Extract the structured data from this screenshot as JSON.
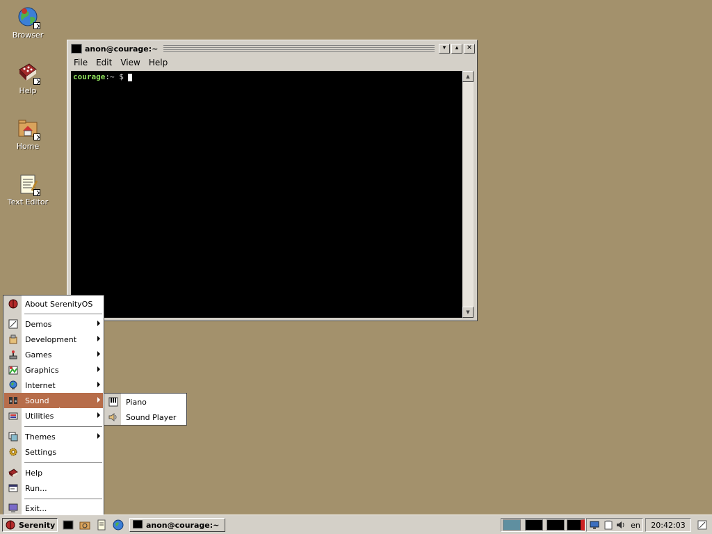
{
  "desktop": {
    "icons": [
      {
        "label": "Browser",
        "icon": "globe-icon"
      },
      {
        "label": "Help",
        "icon": "help-book-icon"
      },
      {
        "label": "Home",
        "icon": "home-folder-icon"
      },
      {
        "label": "Text Editor",
        "icon": "text-editor-icon"
      }
    ]
  },
  "window": {
    "title": "anon@courage:~",
    "menus": [
      "File",
      "Edit",
      "View",
      "Help"
    ],
    "prompt_host": "courage",
    "prompt_rest": ":~ $ ",
    "colors": {
      "terminal_bg": "#000000",
      "prompt": "#8fe05c"
    }
  },
  "start_menu": {
    "items": [
      {
        "label": "About SerenityOS",
        "icon": "serenity-ladybug-icon",
        "submenu": false
      },
      {
        "label": "Demos",
        "icon": "demos-icon",
        "submenu": true
      },
      {
        "label": "Development",
        "icon": "development-icon",
        "submenu": true
      },
      {
        "label": "Games",
        "icon": "joystick-icon",
        "submenu": true
      },
      {
        "label": "Graphics",
        "icon": "graphics-icon",
        "submenu": true
      },
      {
        "label": "Internet",
        "icon": "internet-icon",
        "submenu": true
      },
      {
        "label": "Sound",
        "icon": "sound-icon",
        "submenu": true,
        "active": true
      },
      {
        "label": "Utilities",
        "icon": "utilities-icon",
        "submenu": true
      },
      {
        "label": "Themes",
        "icon": "themes-icon",
        "submenu": true
      },
      {
        "label": "Settings",
        "icon": "settings-icon",
        "submenu": false
      },
      {
        "label": "Help",
        "icon": "help-book-icon",
        "submenu": false
      },
      {
        "label": "Run...",
        "icon": "run-icon",
        "submenu": false
      },
      {
        "label": "Exit...",
        "icon": "exit-icon",
        "submenu": false
      }
    ],
    "active_color": "#b76d4a"
  },
  "sound_submenu": {
    "items": [
      {
        "label": "Piano",
        "icon": "piano-icon"
      },
      {
        "label": "Sound Player",
        "icon": "speaker-icon"
      }
    ]
  },
  "taskbar": {
    "start_label": "Serenity",
    "task_label": "anon@courage:~",
    "keyboard_layout": "en",
    "clock": "20:42:03"
  }
}
